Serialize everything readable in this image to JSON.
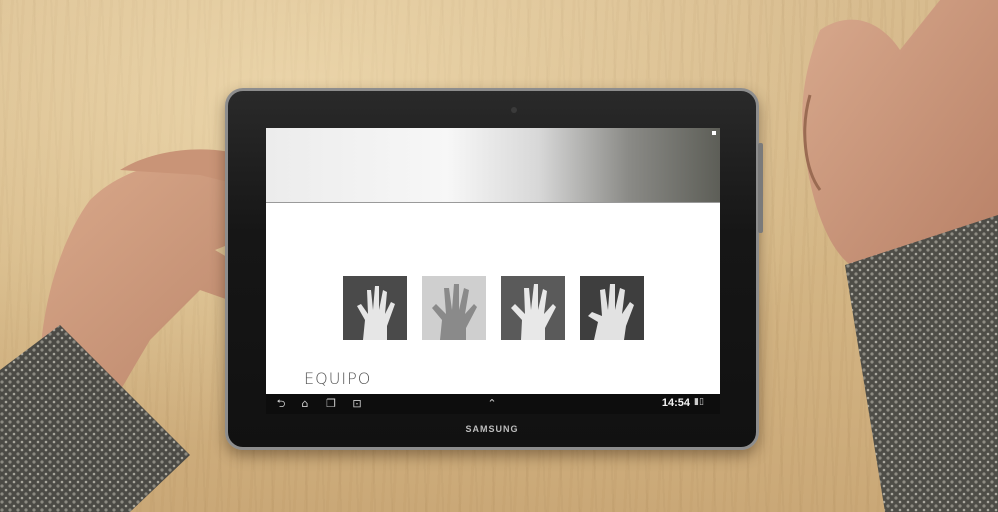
{
  "scene": {
    "device_brand": "SAMSUNG"
  },
  "app": {
    "section_title": "EQUIPO",
    "tiles": [
      {
        "icon": "hand-photo-1"
      },
      {
        "icon": "hand-photo-2"
      },
      {
        "icon": "hand-photo-3"
      },
      {
        "icon": "hand-photo-4"
      }
    ]
  },
  "navbar": {
    "clock": "14:54",
    "icons": [
      "back-icon",
      "home-icon",
      "recent-apps-icon",
      "screenshot-icon",
      "up-chevron-icon"
    ]
  }
}
